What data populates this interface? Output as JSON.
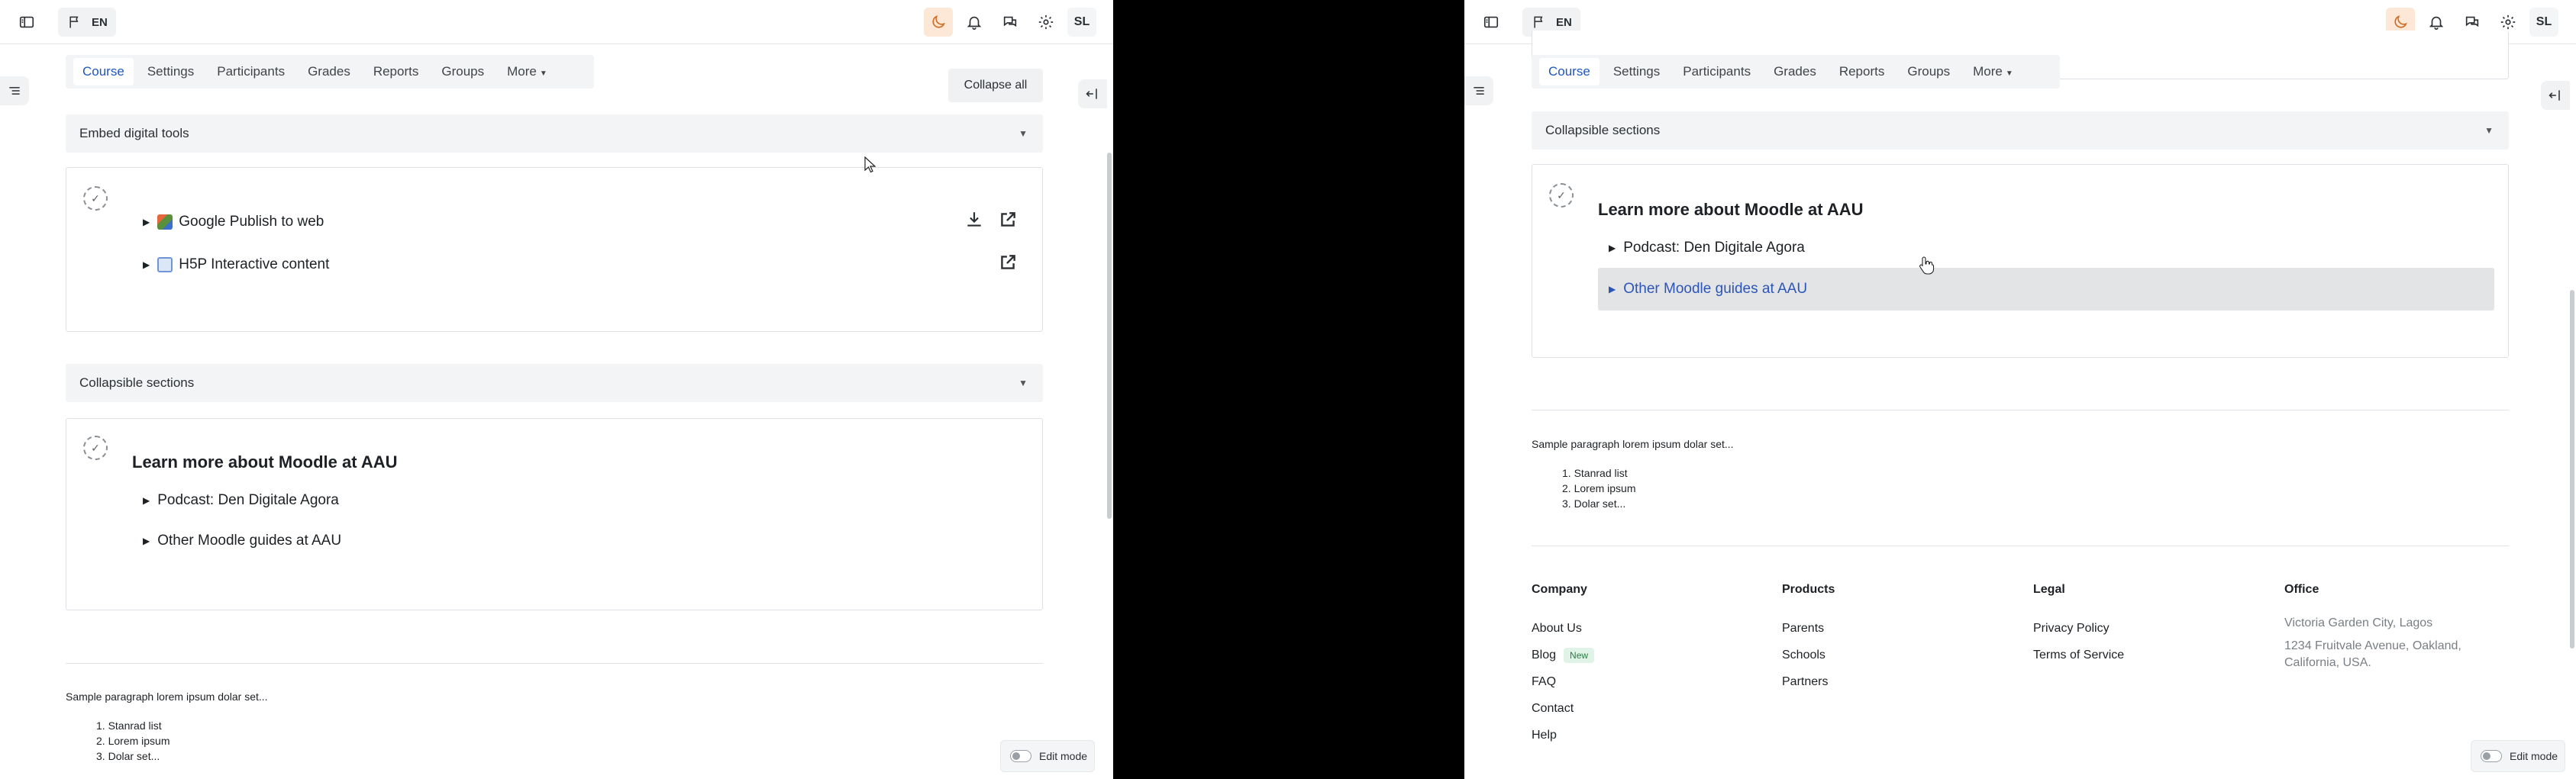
{
  "topbar": {
    "lang": "EN",
    "avatar": "SL"
  },
  "secnav": {
    "tabs": [
      "Course",
      "Settings",
      "Participants",
      "Grades",
      "Reports",
      "Groups",
      "More"
    ],
    "active": "Course"
  },
  "left": {
    "collapse_all": "Collapse all",
    "section1": {
      "title": "Embed digital tools",
      "items": [
        "Google Publish to web",
        "H5P Interactive content"
      ]
    },
    "section2": {
      "title": "Collapsible sections",
      "card_title": "Learn more about Moodle at AAU",
      "items": [
        "Podcast: Den Digitale Agora",
        "Other Moodle guides at AAU"
      ]
    },
    "paragraph": "Sample paragraph lorem ipsum dolar set...",
    "list": [
      "Stanrad list",
      "Lorem ipsum",
      "Dolar set..."
    ],
    "edit_mode": "Edit mode"
  },
  "right": {
    "section": {
      "title": "Collapsible sections",
      "card_title": "Learn more about Moodle at AAU",
      "items": [
        "Podcast: Den Digitale Agora",
        "Other Moodle guides at AAU"
      ]
    },
    "paragraph": "Sample paragraph lorem ipsum dolar set...",
    "list": [
      "Stanrad list",
      "Lorem ipsum",
      "Dolar set..."
    ],
    "footer": {
      "company": {
        "heading": "Company",
        "links": [
          "About Us",
          "Blog",
          "FAQ",
          "Contact",
          "Help"
        ],
        "badge": "New"
      },
      "products": {
        "heading": "Products",
        "links": [
          "Parents",
          "Schools",
          "Partners"
        ]
      },
      "legal": {
        "heading": "Legal",
        "links": [
          "Privacy Policy",
          "Terms of Service"
        ]
      },
      "office": {
        "heading": "Office",
        "lines": [
          "Victoria Garden City, Lagos",
          "1234 Fruitvale Avenue, Oakland, California, USA."
        ]
      }
    },
    "edit_mode": "Edit mode"
  }
}
